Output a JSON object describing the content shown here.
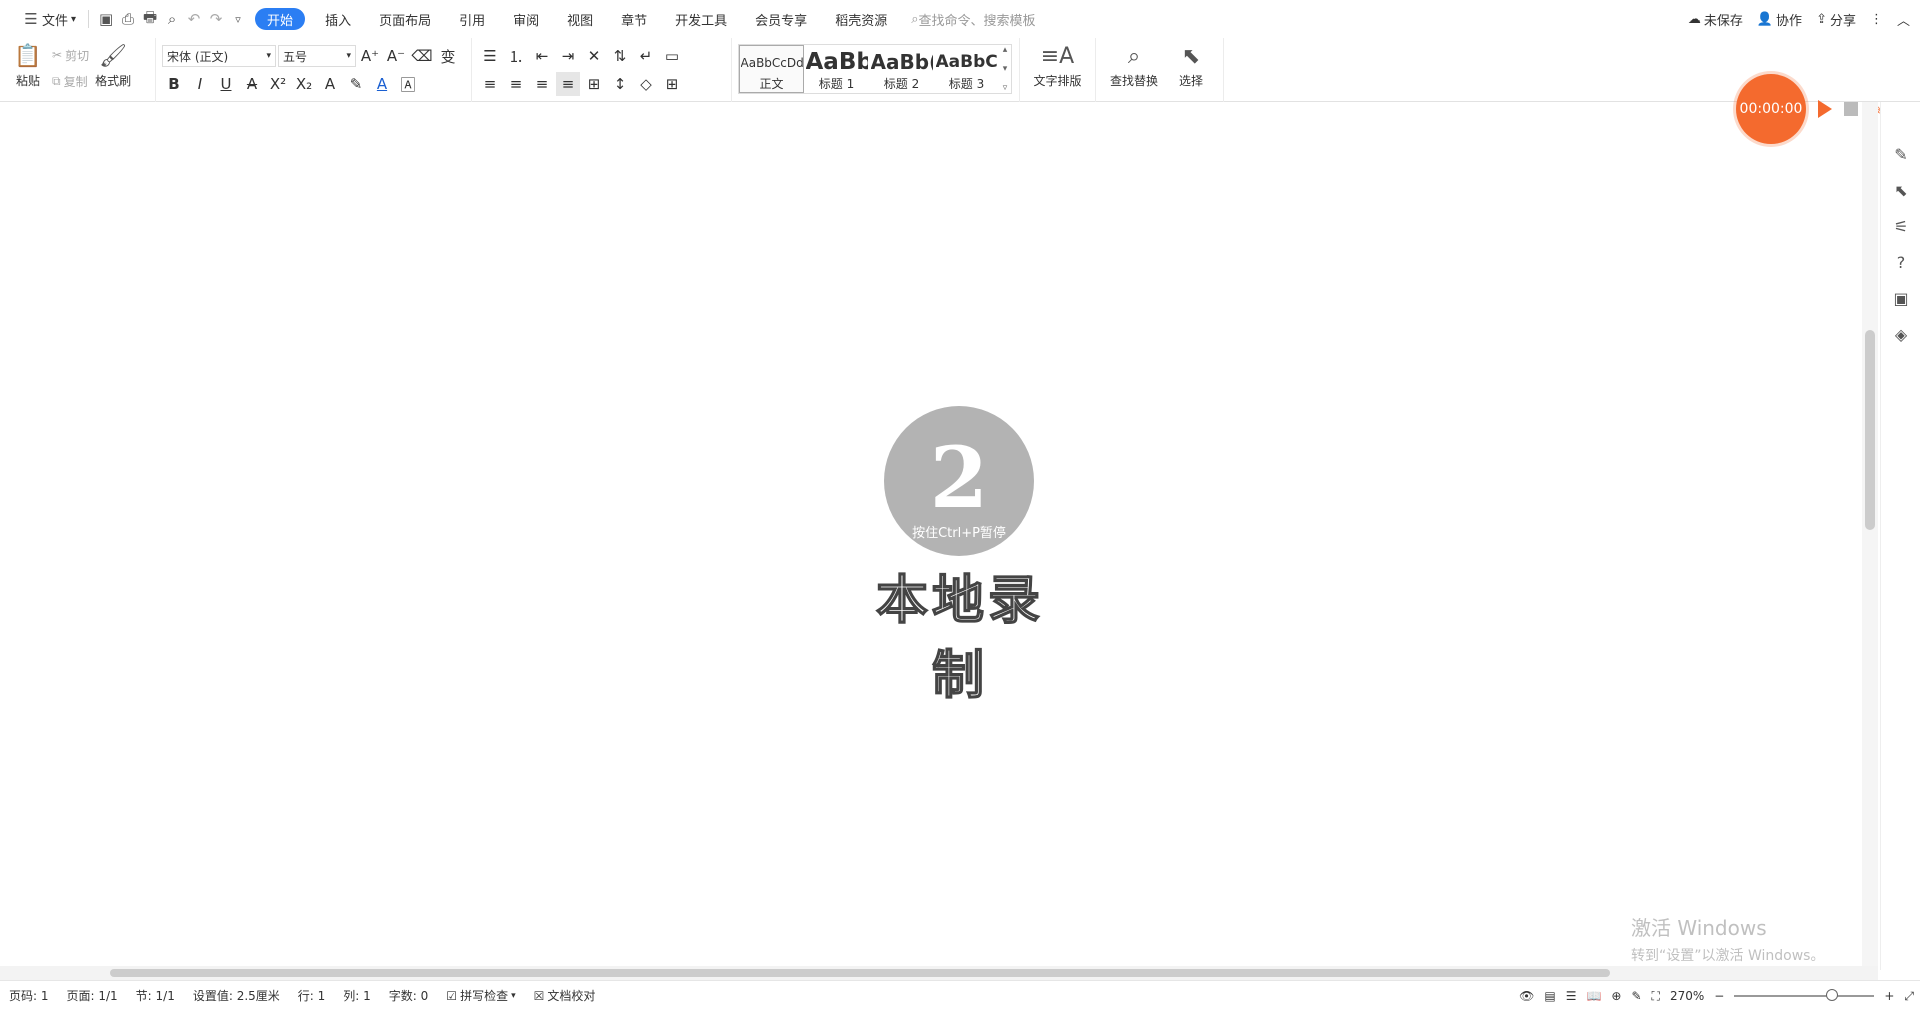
{
  "menubar": {
    "file_label": "文件",
    "tabs": [
      "开始",
      "插入",
      "页面布局",
      "引用",
      "审阅",
      "视图",
      "章节",
      "开发工具",
      "会员专享",
      "稻壳资源"
    ],
    "search_placeholder": "查找命令、搜索模板",
    "unsaved": "未保存",
    "collab": "协作",
    "share": "分享"
  },
  "ribbon": {
    "paste": "粘贴",
    "cut": "剪切",
    "copy": "复制",
    "format_painter": "格式刷",
    "font_name": "宋体 (正文)",
    "font_size": "五号",
    "styles": [
      {
        "preview": "AaBbCcDd",
        "label": "正文"
      },
      {
        "preview": "AaBb",
        "label": "标题 1"
      },
      {
        "preview": "AaBb(",
        "label": "标题 2"
      },
      {
        "preview": "AaBbC(",
        "label": "标题 3"
      }
    ],
    "text_layout": "文字排版",
    "find_replace": "查找替换",
    "select": "选择"
  },
  "recorder": {
    "timer": "00:00:00",
    "countdown": "2",
    "hint": "按住Ctrl+P暂停",
    "title": "本地录制"
  },
  "watermark": {
    "line1": "激活 Windows",
    "line2": "转到“设置”以激活 Windows。"
  },
  "status": {
    "page_code": "页码: 1",
    "page": "页面: 1/1",
    "section": "节: 1/1",
    "setting": "设置值: 2.5厘米",
    "row": "行: 1",
    "col": "列: 1",
    "words": "字数: 0",
    "spell": "拼写检查",
    "proof": "文档校对",
    "zoom": "270%"
  },
  "colors": {
    "accent": "#2b7ef3",
    "record": "#f46a2e"
  }
}
